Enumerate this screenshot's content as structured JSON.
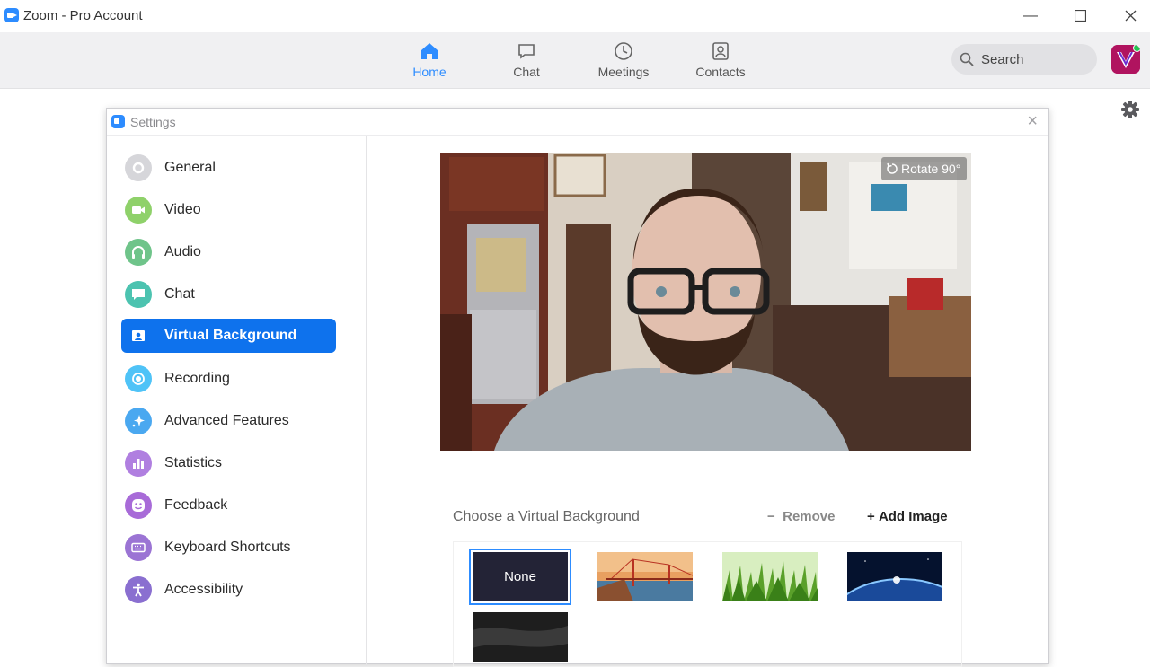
{
  "window": {
    "title": "Zoom - Pro Account"
  },
  "nav": {
    "tabs": [
      {
        "label": "Home",
        "icon": "home-icon",
        "active": true
      },
      {
        "label": "Chat",
        "icon": "chat-icon",
        "active": false
      },
      {
        "label": "Meetings",
        "icon": "clock-icon",
        "active": false
      },
      {
        "label": "Contacts",
        "icon": "contacts-icon",
        "active": false
      }
    ],
    "search_placeholder": "Search"
  },
  "settings": {
    "title": "Settings",
    "sidebar": [
      {
        "label": "General",
        "icon": "gear-icon",
        "color": "#c8c8cc"
      },
      {
        "label": "Video",
        "icon": "video-camera-icon",
        "color": "#8fd16a"
      },
      {
        "label": "Audio",
        "icon": "headphones-icon",
        "color": "#6fc48a"
      },
      {
        "label": "Chat",
        "icon": "chat-bubble-icon",
        "color": "#4cc3b0"
      },
      {
        "label": "Virtual Background",
        "icon": "person-portrait-icon",
        "color": "#0e72ed",
        "active": true
      },
      {
        "label": "Recording",
        "icon": "record-icon",
        "color": "#4fc3f7"
      },
      {
        "label": "Advanced Features",
        "icon": "sparkle-icon",
        "color": "#4aa8f0"
      },
      {
        "label": "Statistics",
        "icon": "bar-chart-icon",
        "color": "#b07fe0"
      },
      {
        "label": "Feedback",
        "icon": "smiley-icon",
        "color": "#a86bd8"
      },
      {
        "label": "Keyboard Shortcuts",
        "icon": "keyboard-icon",
        "color": "#9b74d4"
      },
      {
        "label": "Accessibility",
        "icon": "accessibility-icon",
        "color": "#8a6fd0"
      }
    ],
    "rotate_label": "Rotate 90°",
    "choose_label": "Choose a Virtual Background",
    "remove_label": "Remove",
    "add_image_label": "Add Image",
    "backgrounds": [
      {
        "label": "None",
        "selected": true
      },
      {
        "label": "",
        "kind": "golden-gate-bridge"
      },
      {
        "label": "",
        "kind": "grass"
      },
      {
        "label": "",
        "kind": "earth-from-space"
      },
      {
        "label": "",
        "kind": "dark-texture"
      }
    ]
  }
}
